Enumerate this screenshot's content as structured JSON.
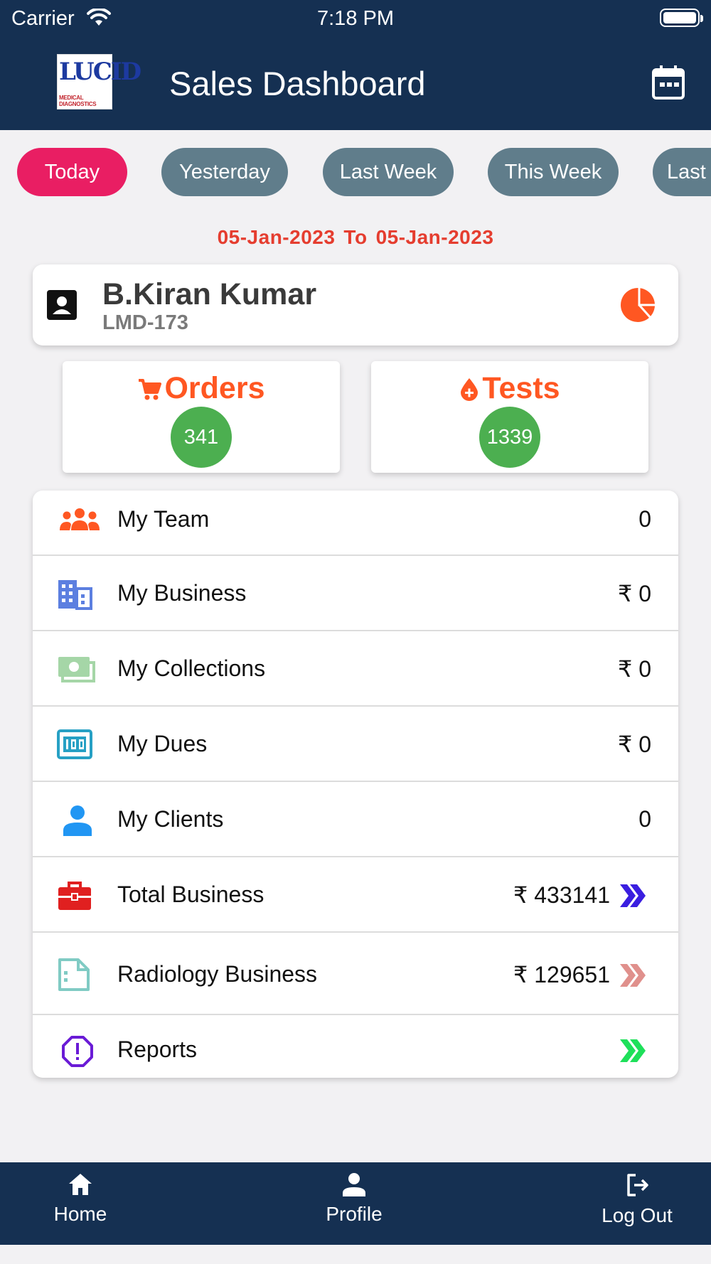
{
  "status_bar": {
    "carrier": "Carrier",
    "time": "7:18 PM"
  },
  "header": {
    "logo_text": "LUCID",
    "logo_subtext": "MEDICAL DIAGNOSTICS",
    "title": "Sales Dashboard",
    "calendar_icon": "calendar-icon"
  },
  "filters": {
    "chips": [
      {
        "label": "Today",
        "active": true
      },
      {
        "label": "Yesterday",
        "active": false
      },
      {
        "label": "Last Week",
        "active": false
      },
      {
        "label": "This Week",
        "active": false
      },
      {
        "label": "Last",
        "active": false
      }
    ],
    "active_color": "#e91e63",
    "inactive_color": "#607d8b"
  },
  "date_range": {
    "from": "05-Jan-2023",
    "separator": "To",
    "to": "05-Jan-2023"
  },
  "profile": {
    "name": "B.Kiran Kumar",
    "code": "LMD-173"
  },
  "stats": {
    "orders": {
      "label": "Orders",
      "count": "341"
    },
    "tests": {
      "label": "Tests",
      "count": "1339"
    }
  },
  "menu": [
    {
      "label": "My Team",
      "value": "0",
      "icon": "team-icon"
    },
    {
      "label": "My Business",
      "value": "₹ 0",
      "icon": "building-icon"
    },
    {
      "label": "My Collections",
      "value": "₹ 0",
      "icon": "money-icon"
    },
    {
      "label": "My Dues",
      "value": "₹ 0",
      "icon": "counter-icon"
    },
    {
      "label": "My Clients",
      "value": "0",
      "icon": "person-icon"
    },
    {
      "label": "Total Business",
      "value": "₹ 433141",
      "icon": "briefcase-icon"
    },
    {
      "label": "Radiology Business",
      "value": "₹ 129651",
      "icon": "document-icon"
    },
    {
      "label": "Reports",
      "value": "",
      "icon": "alert-octagon-icon"
    }
  ],
  "bottom_nav": [
    {
      "label": "Home",
      "icon": "home-icon"
    },
    {
      "label": "Profile",
      "icon": "person-icon"
    },
    {
      "label": "Log Out",
      "icon": "logout-icon"
    }
  ],
  "colors": {
    "header_bg": "#153052",
    "accent_orange": "#ff5722",
    "badge_green": "#4caf50",
    "date_red": "#e53d2f"
  }
}
